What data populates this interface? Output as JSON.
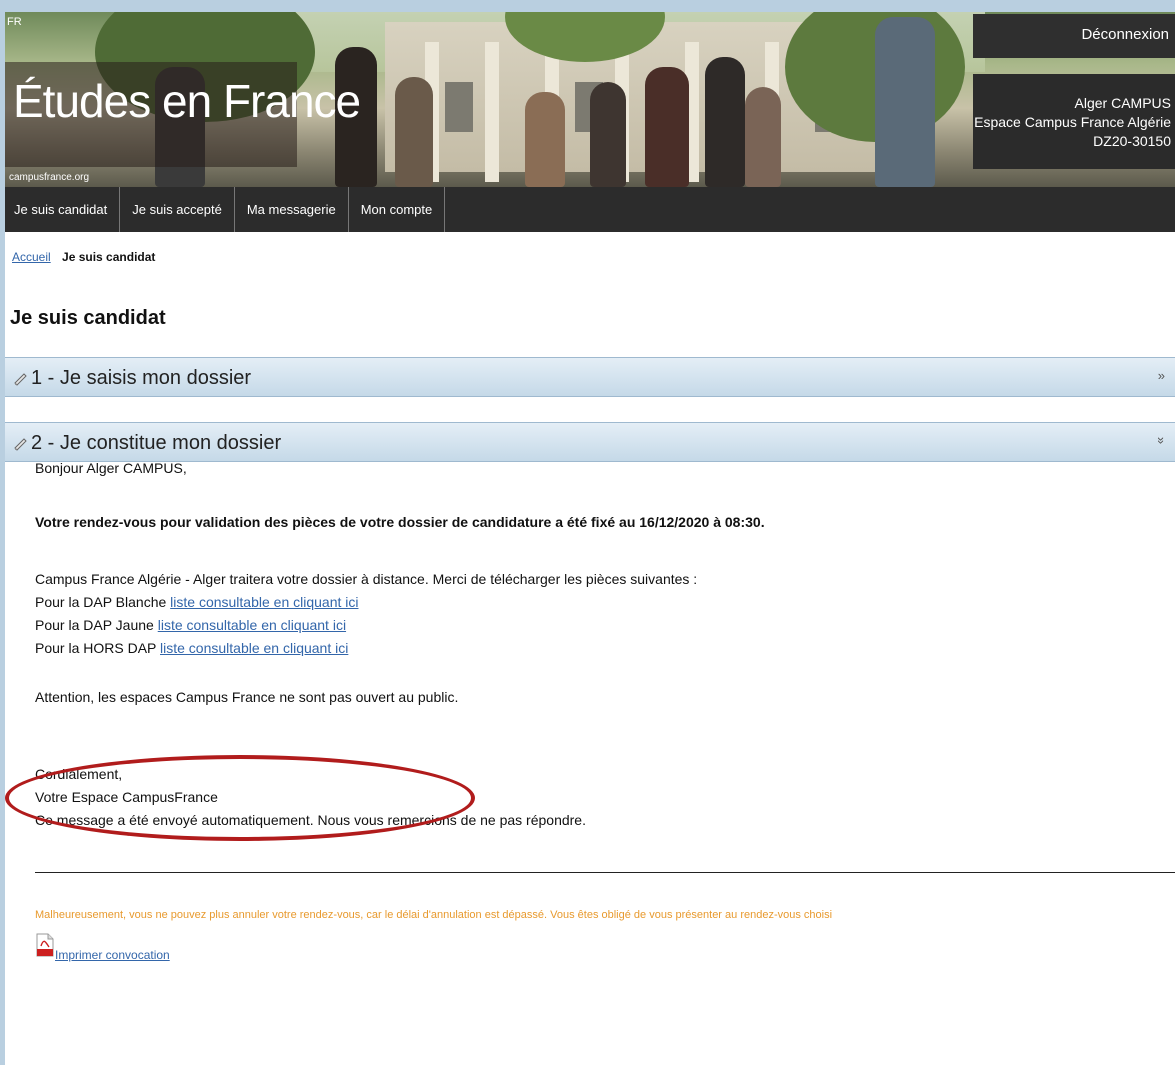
{
  "header": {
    "language": "FR",
    "brand": "Études en France",
    "site_url": "campusfrance.org",
    "logout_label": "Déconnexion",
    "user_name": "Alger CAMPUS",
    "user_space": "Espace Campus France Algérie",
    "user_id": "DZ20-30150"
  },
  "nav": {
    "items": [
      {
        "label": "Je suis candidat"
      },
      {
        "label": "Je suis accepté"
      },
      {
        "label": "Ma messagerie"
      },
      {
        "label": "Mon compte"
      }
    ]
  },
  "breadcrumb": {
    "home": "Accueil",
    "current": "Je suis candidat"
  },
  "page_title": "Je suis candidat",
  "accordion": [
    {
      "label": "1 - Je saisis mon dossier",
      "chevron": "»"
    },
    {
      "label": "2 - Je constitue mon dossier",
      "chevron": "»"
    }
  ],
  "message": {
    "greeting": "Bonjour Alger CAMPUS,",
    "appointment": "Votre rendez-vous pour validation des pièces de votre dossier de candidature a été fixé au 16/12/2020 à 08:30.",
    "intro": "Campus France Algérie - Alger traitera votre dossier à distance. Merci de télécharger les pièces suivantes :",
    "lines": [
      {
        "prefix": "Pour la DAP Blanche ",
        "link": "liste consultable en cliquant ici"
      },
      {
        "prefix": "Pour la DAP Jaune ",
        "link": "liste consultable en cliquant ici"
      },
      {
        "prefix": "Pour la HORS DAP ",
        "link": "liste consultable en cliquant ici"
      }
    ],
    "attention": "Attention, les espaces Campus France ne sont pas ouvert au public.",
    "closing": "Cordialement,",
    "signature": "Votre Espace CampusFrance",
    "auto_note": "Ce message a été envoyé automatiquement. Nous vous remercions de ne pas répondre."
  },
  "warning": "Malheureusement, vous ne pouvez plus annuler votre rendez-vous, car le délai d'annulation est dépassé. Vous êtes obligé de vous présenter au rendez-vous choisi",
  "print_link": "Imprimer convocation",
  "colors": {
    "link": "#3366aa",
    "warning": "#e89a2e",
    "highlight_ellipse": "#b11c1c",
    "nav_bg": "#2c2c2c"
  }
}
